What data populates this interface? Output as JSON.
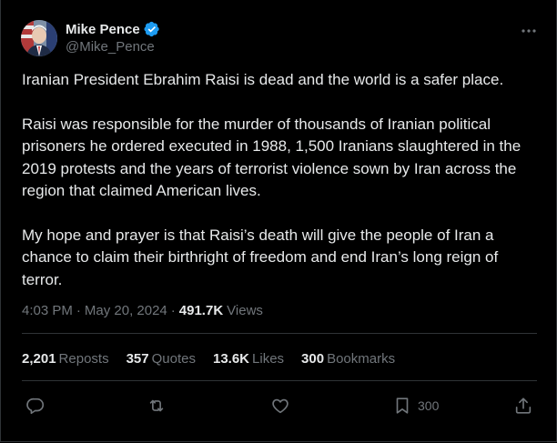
{
  "author": {
    "name": "Mike Pence",
    "handle": "@Mike_Pence"
  },
  "tweet": {
    "paragraphs": [
      "Iranian President Ebrahim Raisi is dead and the world is a safer place.",
      "Raisi was responsible for the murder of thousands of Iranian political prisoners he ordered executed in 1988, 1,500 Iranians slaughtered in the 2019 protests and the years of terrorist violence sown by Iran across the region that claimed American lives.",
      "My hope and prayer is that Raisi’s death will give the people of Iran a chance to claim their birthright of freedom and end Iran’s long reign of terror."
    ],
    "time": "4:03 PM",
    "separator": "·",
    "date": "May 20, 2024",
    "views_count": "491.7K",
    "views_label": "Views"
  },
  "stats": {
    "reposts_count": "2,201",
    "reposts_label": "Reposts",
    "quotes_count": "357",
    "quotes_label": "Quotes",
    "likes_count": "13.6K",
    "likes_label": "Likes",
    "bookmarks_count": "300",
    "bookmarks_label": "Bookmarks"
  },
  "actions": {
    "bookmark_count": "300"
  },
  "colors": {
    "background": "#000000",
    "text": "#e7e9ea",
    "muted": "#71767b",
    "divider": "#2f3336",
    "verified": "#1d9bf0"
  },
  "icons": {
    "verified": "verified-badge-icon",
    "more": "more-icon",
    "reply": "reply-icon",
    "repost": "repost-icon",
    "like": "heart-icon",
    "bookmark": "bookmark-icon",
    "share": "share-icon"
  }
}
